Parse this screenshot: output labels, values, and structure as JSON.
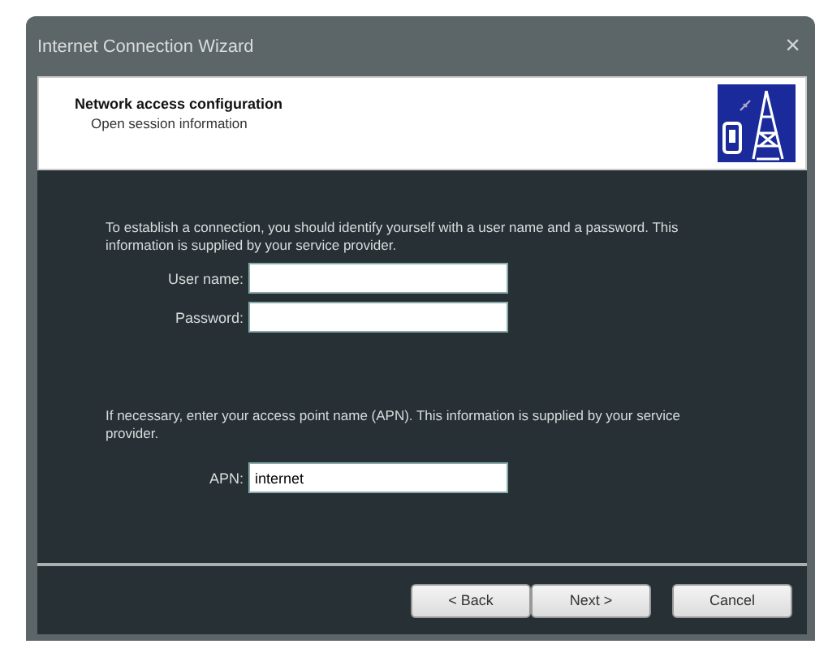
{
  "window": {
    "title": "Internet Connection Wizard",
    "close": "×"
  },
  "header": {
    "title": "Network access configuration",
    "subtitle": "Open session information"
  },
  "intro": "To establish a connection, you should identify yourself with a user name and a password. This information is supplied by your service provider.",
  "credentials": [
    {
      "label": "User name:"
    },
    {
      "label": "Password:"
    }
  ],
  "apn_intro": "If necessary, enter your access point name (APN). This information is supplied by your service provider.",
  "apn": {
    "label": "APN:",
    "value": "internet"
  },
  "buttons": [
    "< Back",
    "Next >",
    "Cancel"
  ]
}
